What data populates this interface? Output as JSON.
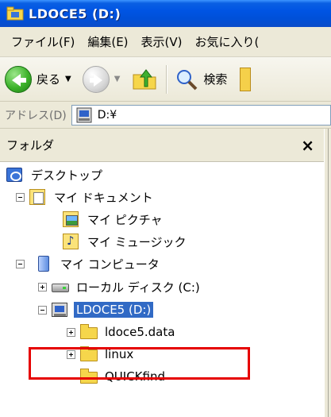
{
  "window": {
    "title": "LDOCE5 (D:)"
  },
  "menu": {
    "items": [
      "ファイル(F)",
      "編集(E)",
      "表示(V)",
      "お気に入り("
    ]
  },
  "toolbar": {
    "back_label": "戻る",
    "search_label": "検索"
  },
  "address": {
    "label": "アドレス(D)",
    "value": "D:¥"
  },
  "folder_pane": {
    "title": "フォルダ",
    "close_symbol": "×",
    "tree": [
      {
        "label": "デスクトップ",
        "icon": "desktop-icon"
      },
      {
        "label": "マイ ドキュメント",
        "icon": "my-documents-icon"
      },
      {
        "label": "マイ ピクチャ",
        "icon": "my-pictures-icon"
      },
      {
        "label": "マイ ミュージック",
        "icon": "my-music-icon"
      },
      {
        "label": "マイ コンピュータ",
        "icon": "my-computer-icon"
      },
      {
        "label": "ローカル ディスク (C:)",
        "icon": "hard-drive-icon"
      },
      {
        "label": "LDOCE5 (D:)",
        "icon": "cd-drive-icon",
        "selected": true
      },
      {
        "label": "ldoce5.data",
        "icon": "folder-icon"
      },
      {
        "label": "linux",
        "icon": "folder-icon"
      },
      {
        "label": "QUICKfind",
        "icon": "folder-icon"
      }
    ]
  },
  "colors": {
    "titlebar": "#0054e3",
    "selection": "#316ac5",
    "highlight_box": "#e60000"
  }
}
